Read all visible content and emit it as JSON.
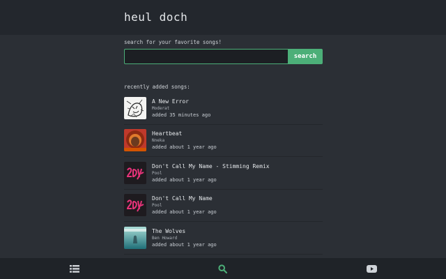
{
  "header": {
    "title": "heul doch"
  },
  "search": {
    "prompt": "search for your favorite songs!",
    "value": "",
    "placeholder": "",
    "button_label": "search"
  },
  "recent": {
    "heading": "recently added songs:",
    "songs": [
      {
        "title": "A New Error",
        "artist": "Moderat",
        "added": "added 35 minutes ago",
        "cover": "sketch-cover"
      },
      {
        "title": "Heartbeat",
        "artist": "Nneka",
        "added": "added about 1 year ago",
        "cover": "portrait-cover"
      },
      {
        "title": "Don't Call My Name - Stimming Remix",
        "artist": "Pool",
        "added": "added about 1 year ago",
        "cover": "pink-logo-cover"
      },
      {
        "title": "Don't Call My Name",
        "artist": "Pool",
        "added": "added about 1 year ago",
        "cover": "pink-logo-cover"
      },
      {
        "title": "The Wolves",
        "artist": "Ben Howard",
        "added": "added about 1 year ago",
        "cover": "underwater-cover"
      }
    ]
  },
  "nav": {
    "items": [
      "list-icon",
      "search-icon",
      "youtube-icon"
    ],
    "active": "search-icon",
    "accent": "#4caf78"
  }
}
